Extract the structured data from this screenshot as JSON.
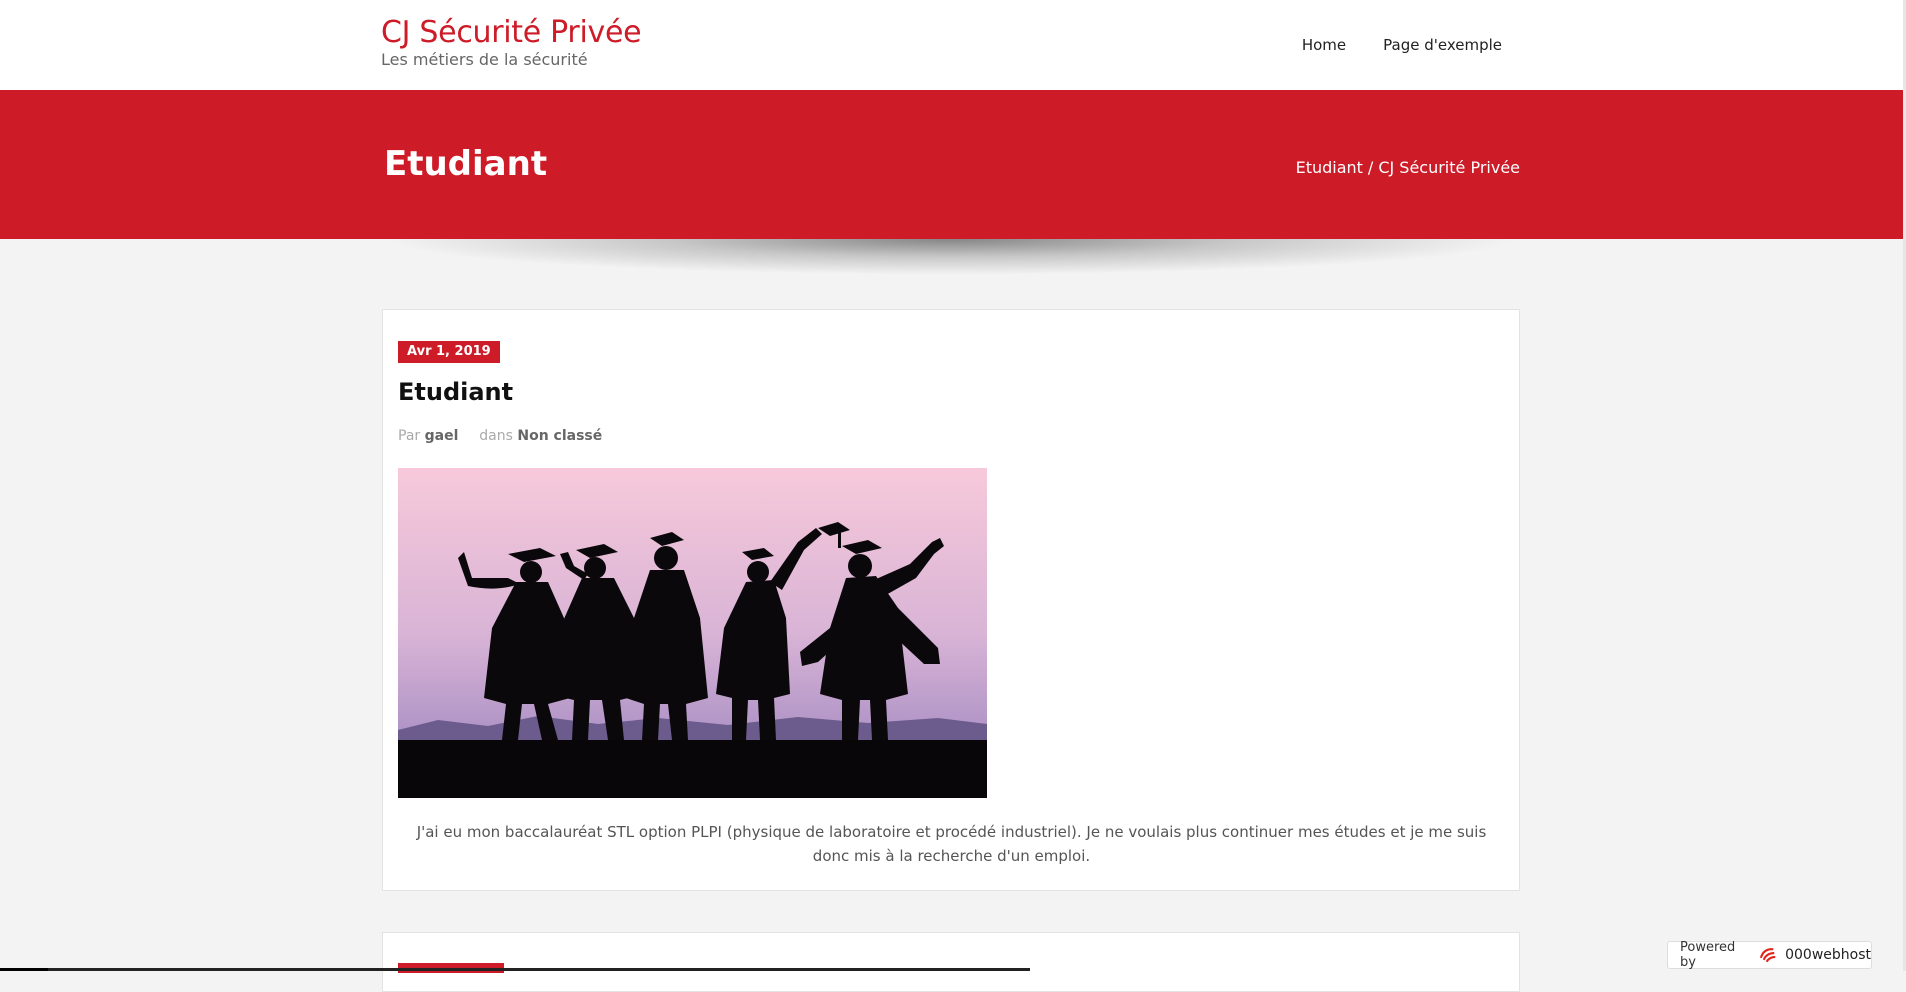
{
  "header": {
    "site_title": "CJ Sécurité Privée",
    "tagline": "Les métiers de la sécurité",
    "nav": [
      "Home",
      "Page d'exemple"
    ]
  },
  "banner": {
    "title": "Etudiant",
    "breadcrumb": [
      "Etudiant",
      "CJ Sécurité Privée"
    ],
    "separator": "/"
  },
  "post": {
    "date": "Avr 1, 2019",
    "title": "Etudiant",
    "meta_by_label": "Par",
    "author": "gael",
    "meta_in_label": "dans",
    "category": "Non classé",
    "image_alt": "Silhouettes de diplômés",
    "body": "J'ai eu mon baccalauréat STL option PLPI (physique de laboratoire et procédé industriel). Je ne voulais plus continuer mes études et je me suis donc mis à la recherche d'un emploi."
  },
  "footer": {
    "powered_label": "Powered by",
    "host_name": "000webhost"
  },
  "colors": {
    "accent": "#cd1b28",
    "background": "#f3f3f3"
  }
}
